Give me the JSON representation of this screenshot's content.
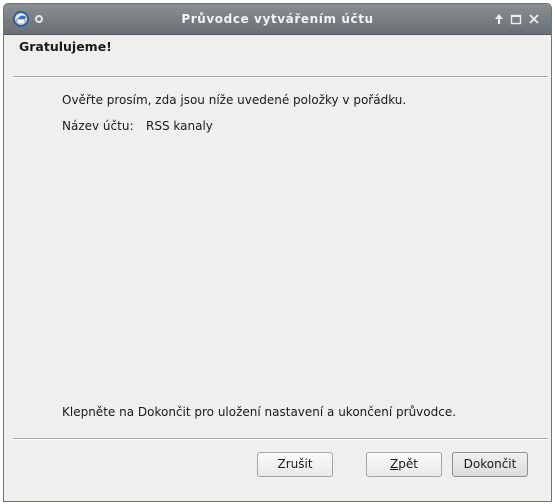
{
  "window": {
    "title": "Průvodce vytvářením účtu"
  },
  "page": {
    "heading": "Gratulujeme!",
    "intro": "Ověřte prosím, zda jsou níže uvedené položky v pořádku.",
    "account_name_label": "Název účtu:",
    "account_name_value": "RSS kanaly",
    "footer_note": "Klepněte na Dokončit pro uložení nastavení a ukončení průvodce."
  },
  "buttons": {
    "cancel": "Zrušit",
    "back_mnemonic": "Z",
    "back_rest": "pět",
    "finish": "Dokončit"
  },
  "icons": {
    "app": "thunderbird-icon",
    "menu": "window-menu-icon",
    "keep_above": "arrow-up-icon",
    "maximize": "maximize-icon",
    "close": "close-icon"
  }
}
